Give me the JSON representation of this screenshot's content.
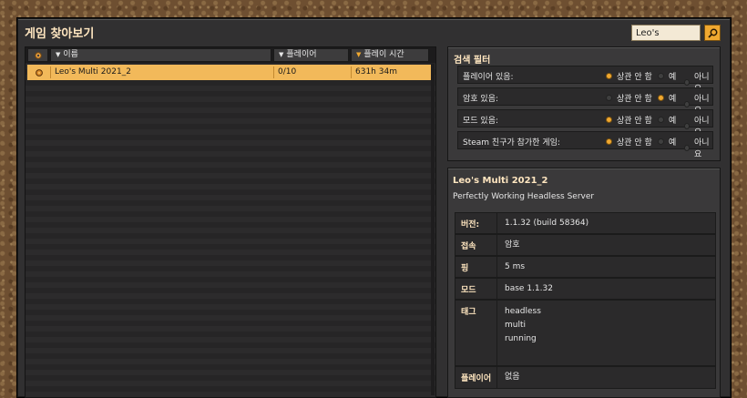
{
  "window": {
    "title": "게임 찾아보기"
  },
  "search": {
    "value": "Leo's"
  },
  "list": {
    "columns": {
      "name": "이름",
      "players": "플레이어",
      "time": "플레이 시간"
    },
    "rows": [
      {
        "name": "Leo's Multi 2021_2",
        "players": "0/10",
        "time": "631h 34m",
        "selected": true
      }
    ]
  },
  "filter": {
    "title": "검색 필터",
    "options": [
      "상관 안 함",
      "예",
      "아니요"
    ],
    "rows": [
      {
        "label": "플레이어 있음:",
        "selected": 0
      },
      {
        "label": "암호 있음:",
        "selected": 1
      },
      {
        "label": "모드 있음:",
        "selected": 0
      },
      {
        "label": "Steam 친구가 참가한 게임:",
        "selected": 0
      }
    ]
  },
  "detail": {
    "name": "Leo's Multi 2021_2",
    "description": "Perfectly Working Headless Server",
    "fields": {
      "version_label": "버전:",
      "version": "1.1.32 (build 58364)",
      "access_label": "접속",
      "access": "암호",
      "ping_label": "핑",
      "ping": "5 ms",
      "mods_label": "모드",
      "mods": "base 1.1.32",
      "tags_label": "태그",
      "tags": [
        "headless",
        "multi",
        "running"
      ],
      "players_label": "플레이어",
      "players": "없음"
    }
  },
  "colors": {
    "accent": "#f0a830",
    "selected_row": "#f2b95a",
    "heading": "#ffe6c0"
  }
}
